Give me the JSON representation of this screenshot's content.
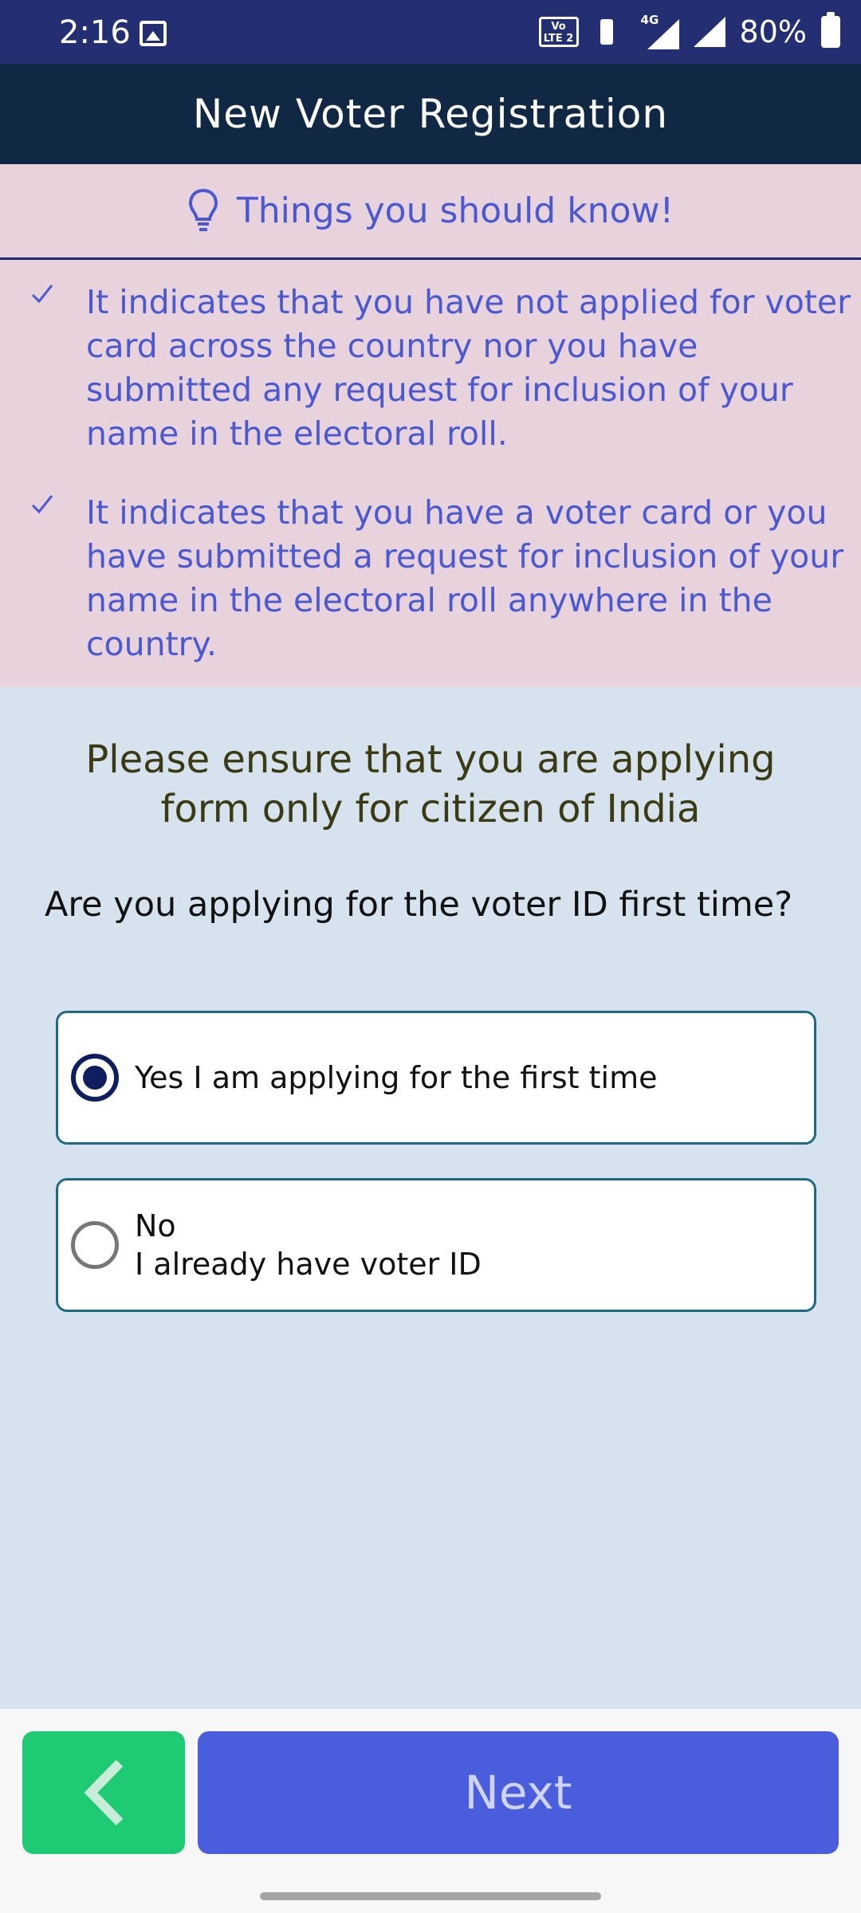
{
  "status_bar": {
    "time": "2:16",
    "volte_label_top": "Vo",
    "volte_label_bottom": "LTE 2",
    "network_label": "4G",
    "battery": "80%"
  },
  "header": {
    "title": "New Voter Registration"
  },
  "info": {
    "title": "Things you should know!",
    "items": [
      "It indicates that you have not applied for voter card across the country nor you have submitted any request for inclusion of your name in the electoral roll.",
      "It indicates that you have a voter card or you have submitted a request for inclusion of your name in the electoral roll anywhere in the country."
    ]
  },
  "notice": "Please ensure that you are applying form only for citizen of India",
  "question": "Are you applying for the voter ID first time?",
  "options": [
    {
      "line1": "Yes I am applying for the first time",
      "line2": "",
      "selected": true
    },
    {
      "line1": "No",
      "line2": "I already have voter ID",
      "selected": false
    }
  ],
  "buttons": {
    "next_label": "Next"
  },
  "colors": {
    "status_bar": "#242f73",
    "header": "#102844",
    "info_bg": "#e8d2dc",
    "accent": "#4a59d2",
    "back_button": "#1ecb74",
    "next_button": "#4a5ddd"
  }
}
